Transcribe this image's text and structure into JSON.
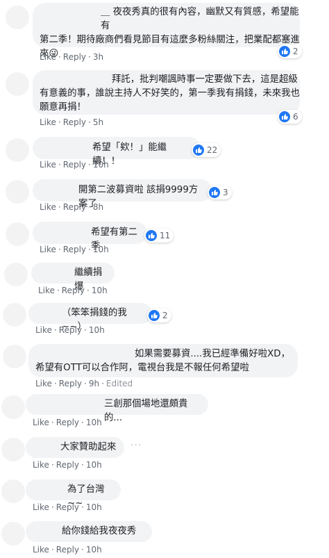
{
  "comments": [
    {
      "lines": [
        "＿ 夜夜秀真的很有內容，幽默又有質感，希望能有",
        "第二季！期待廠商們看見節目有這麼多粉絲關注，把業配都塞進",
        "來😜"
      ],
      "reaction_count": "2",
      "like_label": "Like",
      "reply_label": "Reply",
      "time": "3h"
    },
    {
      "lines": [
        "拜託，批判嘲諷時事一定要做下去，這是超級",
        "有意義的事，誰說主持人不好笑的，第一季我有捐錢，未來我也",
        "願意再捐！"
      ],
      "reaction_count": "6",
      "like_label": "Like",
      "reply_label": "Reply",
      "time": "5h"
    },
    {
      "lines": [
        "希望「欸！」能繼續！！"
      ],
      "reaction_count": "22",
      "like_label": "Like",
      "reply_label": "Reply",
      "time": "10h"
    },
    {
      "lines": [
        "開第二波募資啦 該捐9999方案了"
      ],
      "reaction_count": "3",
      "like_label": "Like",
      "reply_label": "Reply",
      "time": "8h"
    },
    {
      "lines": [
        "希望有第二季"
      ],
      "reaction_count": "11",
      "like_label": "Like",
      "reply_label": "Reply",
      "time": "10h"
    },
    {
      "lines": [
        "繼續捐爆"
      ],
      "like_label": "Like",
      "reply_label": "Reply",
      "time": "10h"
    },
    {
      "lines": [
        "（笨笨捐錢的我~~）"
      ],
      "reaction_count": "2",
      "like_label": "Like",
      "reply_label": "Reply",
      "time": "10h"
    },
    {
      "lines": [
        "如果需要募資....我已經準備好啦XD，",
        "希望有OTT可以合作阿，電視台我是不報任何希望啦"
      ],
      "like_label": "Like",
      "reply_label": "Reply",
      "time": "9h",
      "edited_label": "Edited"
    },
    {
      "lines": [
        "三創那個場地還頗貴的..."
      ],
      "like_label": "Like",
      "reply_label": "Reply",
      "time": "10h"
    },
    {
      "lines": [
        "大家贊助起來"
      ],
      "like_label": "Like",
      "reply_label": "Reply",
      "time": "10h",
      "more": "···"
    },
    {
      "lines": [
        "為了台灣~~"
      ],
      "like_label": "Like",
      "reply_label": "Reply",
      "time": "10h"
    },
    {
      "lines": [
        "給你錢給我夜夜秀"
      ],
      "like_label": "Like",
      "reply_label": "Reply",
      "time": "10h"
    }
  ],
  "colors": {
    "bubble": "#f2f3f5",
    "like_blue": "#2078f4",
    "meta_text": "#606770"
  },
  "icons": {
    "reaction": "thumbs-up-icon",
    "more": "more-options-icon"
  }
}
